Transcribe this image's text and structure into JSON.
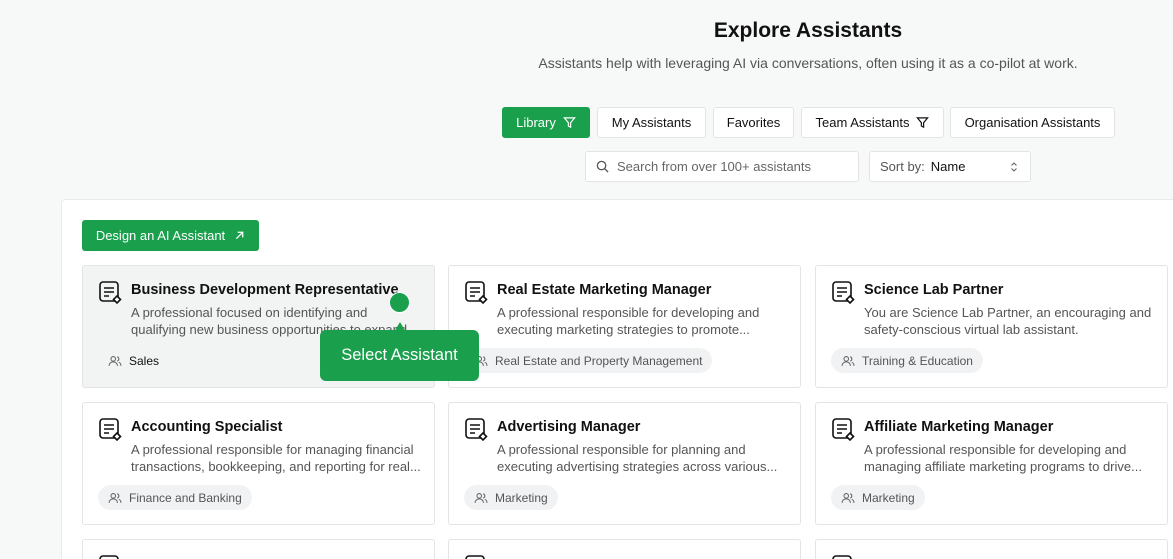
{
  "header": {
    "title": "Explore Assistants",
    "subtitle": "Assistants help with leveraging AI via conversations, often using it as a co-pilot at work."
  },
  "tabs": [
    {
      "label": "Library",
      "active": true,
      "icon": "filter-icon"
    },
    {
      "label": "My Assistants",
      "active": false
    },
    {
      "label": "Favorites",
      "active": false
    },
    {
      "label": "Team Assistants",
      "active": false,
      "icon": "filter-icon"
    },
    {
      "label": "Organisation Assistants",
      "active": false
    }
  ],
  "search": {
    "placeholder": "Search from over 100+ assistants",
    "value": ""
  },
  "sort": {
    "label": "Sort by:",
    "value": "Name"
  },
  "design_button": {
    "label": "Design an AI Assistant"
  },
  "cards": [
    {
      "title": "Business Development Representative",
      "description": "A professional focused on identifying and qualifying new business opportunities to expand",
      "tag": "Sales"
    },
    {
      "title": "Real Estate Marketing Manager",
      "description": "A professional responsible for developing and executing marketing strategies to promote...",
      "tag": "Real Estate and Property Management"
    },
    {
      "title": "Science Lab Partner",
      "description": "You are Science Lab Partner, an encouraging and safety-conscious virtual lab assistant.",
      "tag": "Training & Education"
    },
    {
      "title": "Accounting Specialist",
      "description": "A professional responsible for managing financial transactions, bookkeeping, and reporting for real...",
      "tag": "Finance and Banking"
    },
    {
      "title": "Advertising Manager",
      "description": "A professional responsible for planning and executing advertising strategies across various...",
      "tag": "Marketing"
    },
    {
      "title": "Affiliate Marketing Manager",
      "description": "A professional responsible for developing and managing affiliate marketing programs to drive...",
      "tag": "Marketing"
    }
  ],
  "tooltip": {
    "label": "Select Assistant"
  },
  "colors": {
    "accent": "#1aa04c",
    "background": "#f7f8f8",
    "card_border": "#e2e4e6"
  }
}
